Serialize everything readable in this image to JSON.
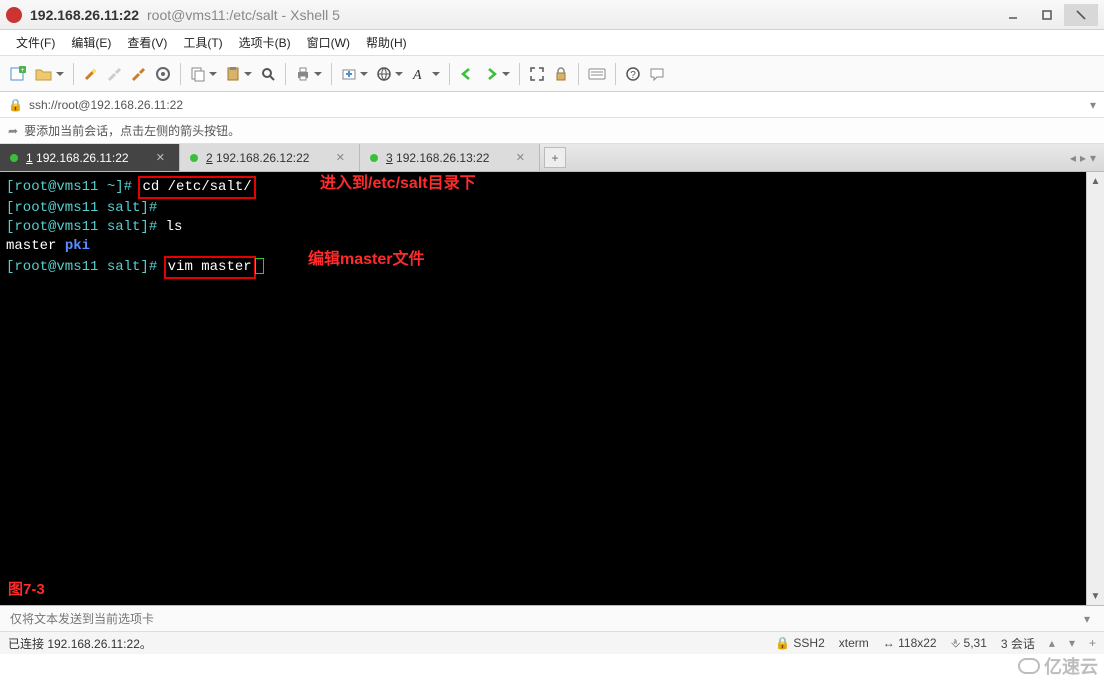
{
  "title": {
    "ip": "192.168.26.11:22",
    "session_path": "root@vms11:/etc/salt - Xshell 5"
  },
  "menu": {
    "file": "文件(F)",
    "edit": "编辑(E)",
    "view": "查看(V)",
    "tools": "工具(T)",
    "tabs": "选项卡(B)",
    "window": "窗口(W)",
    "help": "帮助(H)"
  },
  "address": {
    "url": "ssh://root@192.168.26.11:22"
  },
  "hintbar": {
    "text": "要添加当前会话，点击左侧的箭头按钮。"
  },
  "tabs": [
    {
      "num": "1",
      "label": "192.168.26.11:22",
      "active": true
    },
    {
      "num": "2",
      "label": "192.168.26.12:22",
      "active": false
    },
    {
      "num": "3",
      "label": "192.168.26.13:22",
      "active": false
    }
  ],
  "terminal": {
    "lines": [
      {
        "prompt": "[root@vms11 ~]#",
        "cmd": "cd /etc/salt/",
        "boxed": true
      },
      {
        "prompt": "[root@vms11 salt]#",
        "cmd": ""
      },
      {
        "prompt": "[root@vms11 salt]#",
        "cmd": "ls"
      },
      {
        "output": [
          {
            "t": "master",
            "c": "white"
          },
          {
            "t": "  "
          },
          {
            "t": "pki",
            "c": "blue"
          }
        ]
      },
      {
        "prompt": "[root@vms11 salt]#",
        "cmd": "vim master",
        "boxed": true,
        "cursor": true
      }
    ],
    "annotations": {
      "a1": "进入到/etc/salt目录下",
      "a2": "编辑master文件"
    },
    "figure": "图7-3"
  },
  "sendbar": {
    "placeholder": "仅将文本发送到当前选项卡"
  },
  "status": {
    "left": "已连接 192.168.26.11:22。",
    "proto": "SSH2",
    "termtype": "xterm",
    "size": "118x22",
    "cursor": "5,31",
    "sessions_label": "3 会话"
  },
  "watermark": "亿速云",
  "icons": {
    "lock": "🔒",
    "arrow": "➦",
    "plus": "+",
    "chev_left": "◂",
    "chev_right": "▸",
    "chev_down": "▾",
    "scroll_up": "▲",
    "scroll_down": "▼",
    "size": "↔",
    "pos": "⎀"
  }
}
